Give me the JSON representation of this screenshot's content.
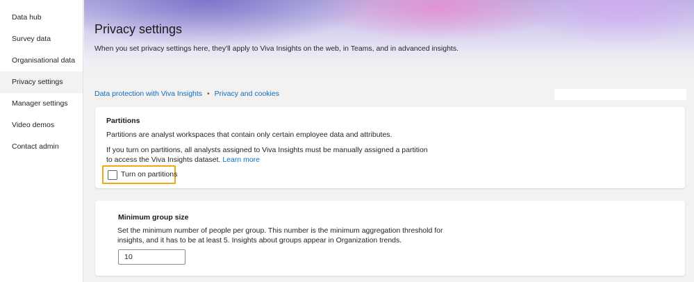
{
  "sidebar": {
    "items": [
      {
        "label": "Data hub"
      },
      {
        "label": "Survey data"
      },
      {
        "label": "Organisational data"
      },
      {
        "label": "Privacy settings"
      },
      {
        "label": "Manager settings"
      },
      {
        "label": "Video demos"
      },
      {
        "label": "Contact admin"
      }
    ],
    "active": "Privacy settings"
  },
  "header": {
    "title": "Privacy settings",
    "description": "When you set privacy settings here, they'll apply to Viva Insights on the web, in Teams, and in advanced insights."
  },
  "links": {
    "data_protection": "Data protection with Viva Insights",
    "separator": "•",
    "privacy_cookies": "Privacy and cookies"
  },
  "search": {
    "value": ""
  },
  "partitions": {
    "title": "Partitions",
    "description": "Partitions are analyst workspaces that contain only certain employee data and attributes.",
    "warning": "If you turn on partitions, all analysts assigned to Viva Insights must be manually assigned a partition to access the Viva Insights dataset.",
    "learn_more": "Learn more",
    "checkbox_label": "Turn on partitions",
    "checked": false,
    "highlight_color": "#f3a712"
  },
  "min_group": {
    "title": "Minimum group size",
    "description": "Set the minimum number of people per group. This number is the minimum aggregation threshold for insights, and it has to be at least 5. Insights about groups appear in Organization trends.",
    "value": "10"
  },
  "colors": {
    "link": "#0f6cbd",
    "accent_highlight": "#f3a712"
  }
}
